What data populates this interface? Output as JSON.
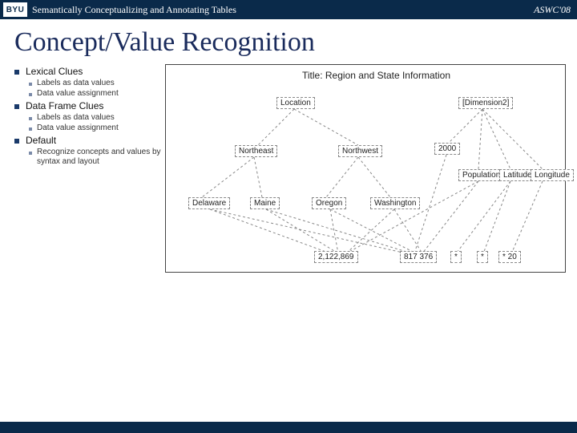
{
  "topbar": {
    "logo": "BYU",
    "title": "Semantically Conceptualizing and Annotating Tables",
    "right": "ASWC'08"
  },
  "slide_title": "Concept/Value Recognition",
  "bullets": [
    {
      "label": "Lexical Clues",
      "children": [
        "Labels as data values",
        "Data value assignment"
      ]
    },
    {
      "label": "Data Frame Clues",
      "children": [
        "Labels as data values",
        "Data value assignment"
      ]
    },
    {
      "label": "Default",
      "children": [
        "Recognize concepts and values by syntax and layout"
      ]
    }
  ],
  "diagram": {
    "title": "Title: Region and State Information",
    "nodes": {
      "location": "Location",
      "dim2": "[Dimension2]",
      "northeast": "Northeast",
      "northwest": "Northwest",
      "year": "2000",
      "population": "Population",
      "latitude": "Latitude",
      "longitude": "Longitude",
      "delaware": "Delaware",
      "maine": "Maine",
      "oregon": "Oregon",
      "washington": "Washington",
      "v1": "2,122,869",
      "v2": "817 376",
      "v3": "*",
      "v4": "*",
      "v5": "* 20"
    }
  }
}
